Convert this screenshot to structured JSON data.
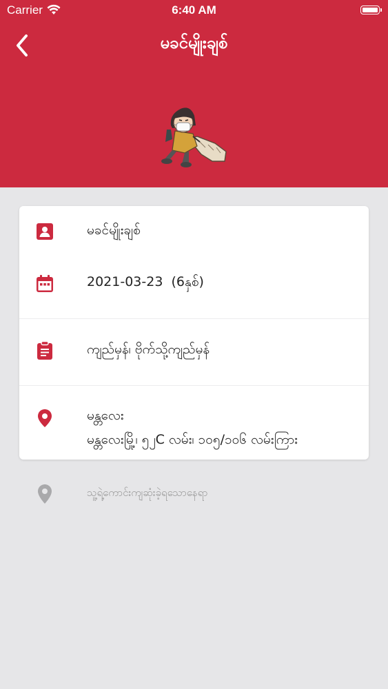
{
  "status_bar": {
    "carrier": "Carrier",
    "time": "6:40 AM"
  },
  "nav": {
    "title": "မခင်မျိုးချစ်"
  },
  "details": {
    "name": "မခင်မျိုးချစ်",
    "birth_date": "2021-03-23",
    "age": "(6နှစ်)",
    "description": "ကျည်မှန်၊ ဗိုက်သို့ကျည်မှန်",
    "location_title": "မန္တလေး",
    "location_address": "မန္တလေးမြို့၊ ၅၂C လမ်း၊ ၁၀၅/၁၀၆ လမ်းကြား"
  },
  "last_location": {
    "label": "သူ့ရဲ့ကောင်းကျဆုံးခဲ့ရသောနေရာ"
  },
  "colors": {
    "brand": "#cc2a3f",
    "background": "#e6e6e8",
    "muted": "#9a9a9a"
  },
  "icons": [
    "back-chevron",
    "person-badge",
    "calendar",
    "clipboard",
    "map-pin"
  ]
}
